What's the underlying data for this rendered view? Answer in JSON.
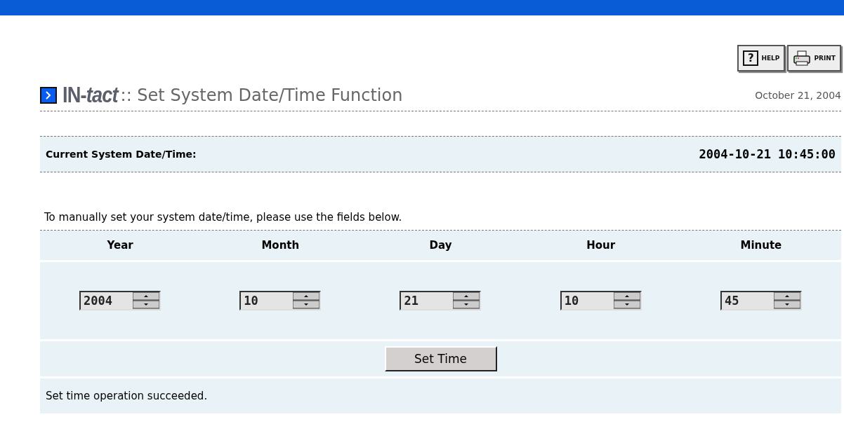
{
  "toolbar": [
    {
      "kind": "help",
      "glyph": "?",
      "label": "HELP"
    },
    {
      "kind": "print",
      "label": "PRINT"
    }
  ],
  "header": {
    "brand_main": "IN-",
    "brand_italic": "tact",
    "title": ":: Set System Date/Time Function",
    "date": "October 21, 2004"
  },
  "current": {
    "label": "Current System Date/Time:",
    "value": "2004-10-21 10:45:00"
  },
  "instruction": "To manually set your system date/time, please use the fields below.",
  "fields": [
    {
      "label": "Year",
      "value": "2004"
    },
    {
      "label": "Month",
      "value": "10"
    },
    {
      "label": "Day",
      "value": "21"
    },
    {
      "label": "Hour",
      "value": "10"
    },
    {
      "label": "Minute",
      "value": "45"
    }
  ],
  "submit": "Set Time",
  "message": "Set time operation succeeded."
}
